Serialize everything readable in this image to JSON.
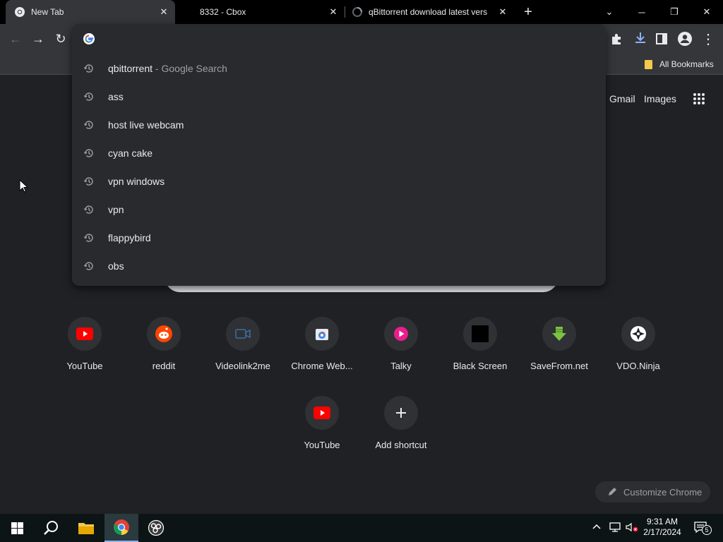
{
  "tabs": [
    {
      "title": "New Tab",
      "close": "✕",
      "active": true
    },
    {
      "title": "8332 - Cbox",
      "close": "✕",
      "active": false
    },
    {
      "title": "qBittorrent download latest vers",
      "close": "✕",
      "active": false
    }
  ],
  "new_tab_glyph": "+",
  "window_controls": {
    "dropdown": "⌄",
    "minimize": "─",
    "restore": "❐",
    "close": "✕"
  },
  "toolbar": {
    "back": "←",
    "forward": "→",
    "reload": "↻",
    "menu": "⋮"
  },
  "omnibox": {
    "value": "",
    "suggestions": [
      {
        "text": "qbittorrent",
        "suffix": " - Google Search"
      },
      {
        "text": "ass",
        "suffix": ""
      },
      {
        "text": "host live webcam",
        "suffix": ""
      },
      {
        "text": "cyan cake",
        "suffix": ""
      },
      {
        "text": "vpn windows",
        "suffix": ""
      },
      {
        "text": "vpn",
        "suffix": ""
      },
      {
        "text": "flappybird",
        "suffix": ""
      },
      {
        "text": "obs",
        "suffix": ""
      }
    ]
  },
  "bookmarks": {
    "all_bookmarks": "All Bookmarks"
  },
  "header_links": {
    "gmail": "Gmail",
    "images": "Images"
  },
  "shortcuts": [
    {
      "label": "YouTube",
      "icon": "youtube-icon"
    },
    {
      "label": "reddit",
      "icon": "reddit-icon"
    },
    {
      "label": "Videolink2me",
      "icon": "video-camera-icon"
    },
    {
      "label": "Chrome Web...",
      "icon": "chrome-web-store-icon"
    },
    {
      "label": "Talky",
      "icon": "talky-icon"
    },
    {
      "label": "Black Screen",
      "icon": "black-square-icon"
    },
    {
      "label": "SaveFrom.net",
      "icon": "download-arrow-icon"
    },
    {
      "label": "VDO.Ninja",
      "icon": "vdo-ninja-icon"
    },
    {
      "label": "YouTube",
      "icon": "youtube-icon"
    },
    {
      "label": "Add shortcut",
      "icon": "plus-icon"
    }
  ],
  "customize": {
    "label": "Customize Chrome"
  },
  "taskbar": {
    "time": "9:31 AM",
    "date": "2/17/2024",
    "notification_count": "5"
  },
  "colors": {
    "youtube": "#ff0000",
    "reddit": "#ff4500",
    "talky": "#e91e8c",
    "savefrom": "#7bc143",
    "accent": "#8ab4f8"
  }
}
